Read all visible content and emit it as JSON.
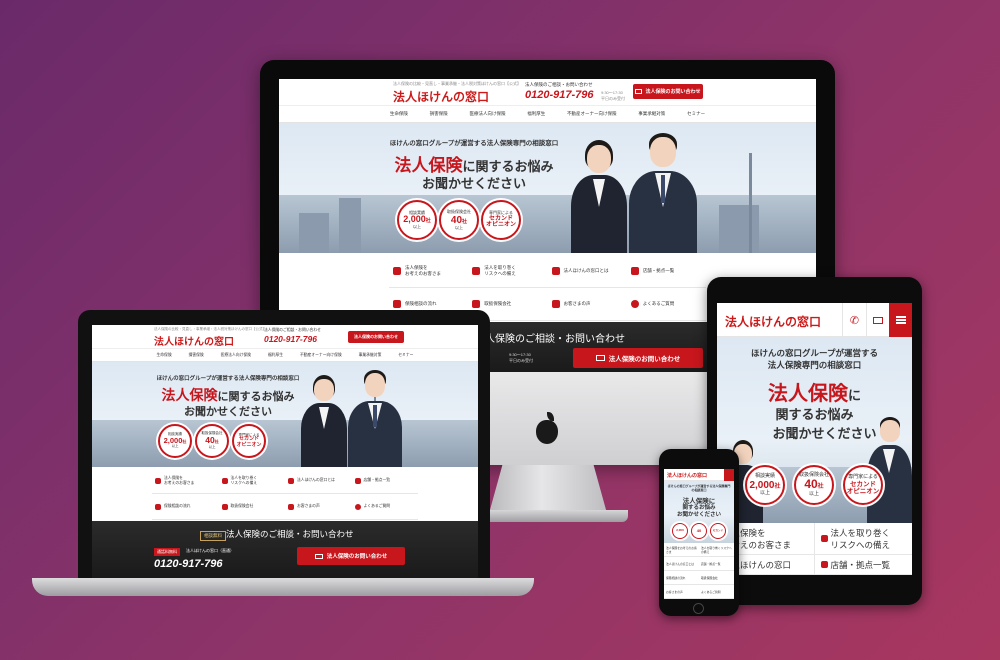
{
  "brand": {
    "logo": "法人ほけんの窓口",
    "accent": "#c8161d"
  },
  "desktop": {
    "tagline": "法人保険の比較・見直し・事業承継・法人税対策ほけんの窓口【公式】",
    "consult_label": "法人保険のご相談・お問い合わせ",
    "phone": "0120-917-796",
    "hours": "9:30〜17:30\n平日のみ受付",
    "cta": "法人保険のお問い合わせ",
    "nav": [
      "生命保険",
      "損害保険",
      "医療法人向け保険",
      "福利厚生",
      "不動産オーナー向け保険",
      "事業承継対策",
      "セミナー"
    ],
    "hero_sub": "ほけんの窓口グループが運営する法人保険専門の相談窓口",
    "hero_title_red": "法人保険",
    "hero_title_rest": "に関するお悩み",
    "hero_title_line2": "お聞かせください",
    "badges": [
      {
        "top": "相談実績",
        "big": "2,000",
        "unit": "社",
        "bottom": "以上"
      },
      {
        "top": "取扱保険会社",
        "big": "40",
        "unit": "社",
        "bottom": "以上"
      },
      {
        "top": "専門家による",
        "big": "セカンド",
        "unit": "",
        "bottom": "オピニオン"
      }
    ],
    "menu": [
      {
        "l1": "法人保険を",
        "l2": "お考えのお客さま"
      },
      {
        "l1": "法人を取り巻く",
        "l2": "リスクへの備え"
      },
      {
        "l1": "法人ほけんの窓口とは",
        "l2": ""
      },
      {
        "l1": "店舗・拠点一覧",
        "l2": ""
      },
      {
        "l1": "保険相談の流れ",
        "l2": ""
      },
      {
        "l1": "取扱保険会社",
        "l2": ""
      },
      {
        "l1": "お客さまの声",
        "l2": ""
      },
      {
        "l1": "よくあるご質問",
        "l2": ""
      }
    ],
    "contact_badge": "相談無料",
    "contact_title": "法人保険のご相談・お問い合わせ",
    "contact_office": "法人ほけんの窓口（直通）",
    "contact_label": "通話料無料"
  },
  "tablet": {
    "hero_sub1": "ほけんの窓口グループが運営する",
    "hero_sub2": "法人保険専門の相談窓口",
    "title_red": "法人保険",
    "title_rest": "に",
    "title_line2": "関するお悩み",
    "title_line3": "お聞かせください",
    "menu": [
      "法人保険を",
      "お考えのお客さま",
      "法人を取り巻く",
      "リスクへの備え",
      "法人ほけんの窓口",
      "店舗・拠点一覧"
    ]
  },
  "phone": {
    "hero_sub": "ほけんの窓口グループが運営する法人保険専門の相談窓口",
    "title_l1": "法人保険に",
    "title_l2": "関するお悩み",
    "title_l3": "お聞かせください",
    "menu": [
      "法人保険をお考えのお客さま",
      "法人を取り巻くリスクへの備え",
      "法人ほけんの窓口とは",
      "店舗・拠点一覧",
      "保険相談の流れ",
      "取扱保険会社",
      "お客さまの声",
      "よくあるご質問"
    ]
  },
  "devices": {
    "monitor_logo": "apple-logo"
  }
}
